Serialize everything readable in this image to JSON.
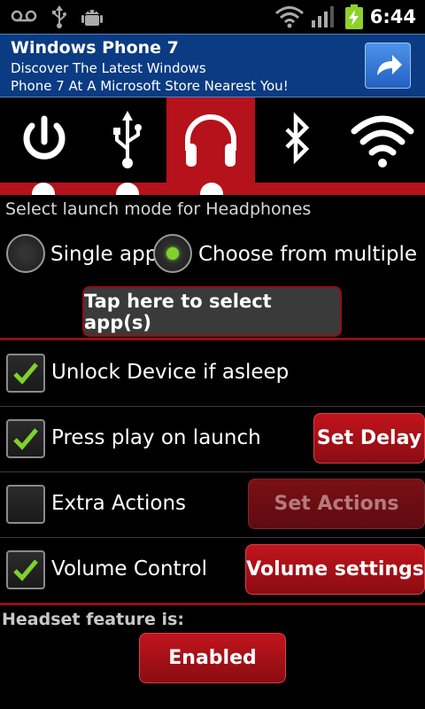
{
  "status_bar": {
    "time": "6:44",
    "icons": [
      "voicemail-icon",
      "usb-icon",
      "android-debug-icon",
      "wifi-icon",
      "signal-icon",
      "battery-charging-icon"
    ]
  },
  "ad": {
    "title": "Windows Phone 7",
    "line1": "Discover The Latest Windows",
    "line2": "Phone 7 At A Microsoft Store Nearest You!",
    "button_icon": "share-arrow-icon"
  },
  "tabs": [
    {
      "icon": "power-icon",
      "selected": false
    },
    {
      "icon": "usb-icon",
      "selected": false
    },
    {
      "icon": "headphones-icon",
      "selected": true
    },
    {
      "icon": "bluetooth-icon",
      "selected": false
    },
    {
      "icon": "wifi-icon",
      "selected": false
    }
  ],
  "launch_mode": {
    "label": "Select launch mode for Headphones",
    "options": [
      {
        "label": "Single app",
        "selected": false
      },
      {
        "label": "Choose from multiple",
        "selected": true
      }
    ],
    "select_button": "Tap here to select app(s)"
  },
  "options": [
    {
      "label": "Unlock Device if asleep",
      "checked": true,
      "button": null
    },
    {
      "label": "Press play on launch",
      "checked": true,
      "button": "Set Delay"
    },
    {
      "label": "Extra Actions",
      "checked": false,
      "button": "Set Actions",
      "button_disabled": true
    },
    {
      "label": "Volume Control",
      "checked": true,
      "button": "Volume settings"
    }
  ],
  "headset": {
    "label": "Headset feature is:",
    "state_button": "Enabled"
  },
  "colors": {
    "accent": "#b5121b",
    "ad_background": "#0b3b82",
    "radio_on": "#7fd12b",
    "check": "#7fd12b"
  }
}
